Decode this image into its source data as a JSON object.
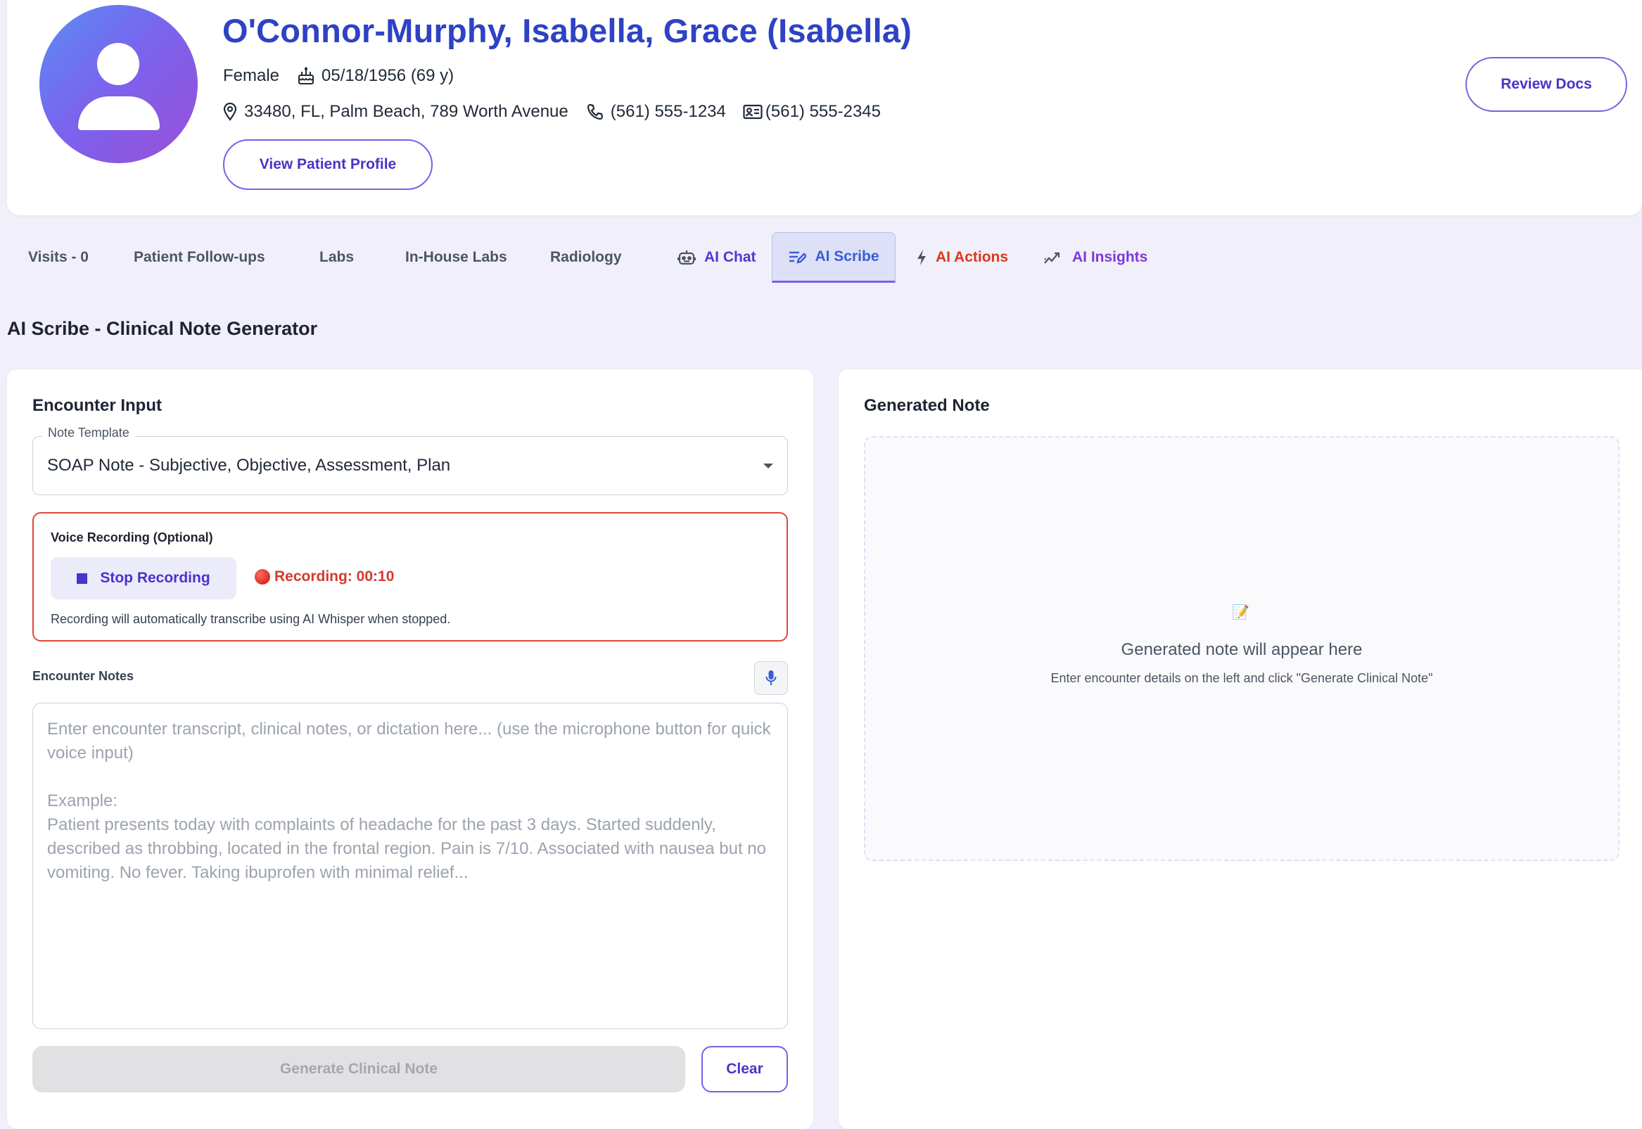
{
  "patient": {
    "name": "O'Connor-Murphy, Isabella, Grace (Isabella)",
    "gender": "Female",
    "dob": "05/18/1956 (69 y)",
    "address": "33480, FL, Palm Beach, 789 Worth Avenue",
    "phone": "(561) 555-1234",
    "fax": "(561) 555-2345"
  },
  "header": {
    "view_profile_label": "View Patient Profile",
    "review_docs_label": "Review Docs"
  },
  "tabs": [
    {
      "label": "Visits - 0"
    },
    {
      "label": "Patient Follow-ups"
    },
    {
      "label": "Labs"
    },
    {
      "label": "In-House Labs"
    },
    {
      "label": "Radiology"
    },
    {
      "label": "AI Chat",
      "icon": "robot-icon"
    },
    {
      "label": "AI Scribe",
      "icon": "edit-lines-icon",
      "active": true
    },
    {
      "label": "AI Actions",
      "icon": "bolt-icon"
    },
    {
      "label": "AI Insights",
      "icon": "trend-icon"
    }
  ],
  "section_title": "AI Scribe - Clinical Note Generator",
  "encounter": {
    "title": "Encounter Input",
    "template_label": "Note Template",
    "template_value": "SOAP Note - Subjective, Objective, Assessment, Plan",
    "voice_label": "Voice Recording (Optional)",
    "stop_label": "Stop Recording",
    "recording_status": "Recording: 00:10",
    "voice_hint": "Recording will automatically transcribe using AI Whisper when stopped.",
    "notes_label": "Encounter Notes",
    "notes_placeholder": "Enter encounter transcript, clinical notes, or dictation here... (use the microphone button for quick voice input)\n\nExample:\nPatient presents today with complaints of headache for the past 3 days. Started suddenly, described as throbbing, located in the frontal region. Pain is 7/10. Associated with nausea but no vomiting. No fever. Taking ibuprofen with minimal relief...",
    "generate_label": "Generate Clinical Note",
    "clear_label": "Clear"
  },
  "generated": {
    "title": "Generated Note",
    "placeholder_icon": "📝",
    "placeholder_title": "Generated note will appear here",
    "placeholder_sub": "Enter encounter details on the left and click \"Generate Clinical Note\""
  },
  "colors": {
    "primary": "#2d42c4",
    "accent": "#7c5fe6",
    "danger": "#e0463a",
    "actions_red": "#d9391f",
    "insights_violet": "#7b3ad8"
  }
}
